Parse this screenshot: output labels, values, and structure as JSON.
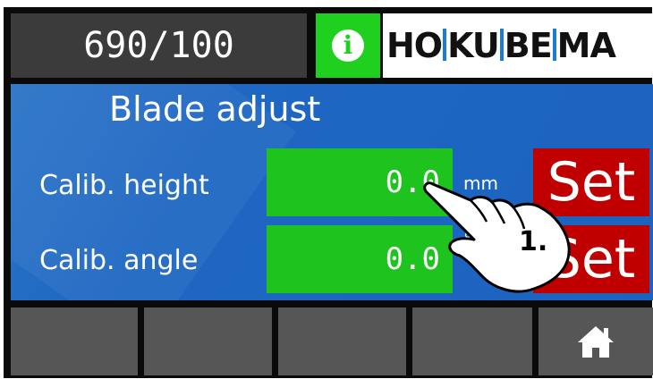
{
  "header": {
    "counter": "690/100",
    "info_icon": "info-icon",
    "logo_parts": [
      "HO",
      "KU",
      "BE",
      "MA"
    ]
  },
  "panel": {
    "title": "Blade adjust",
    "rows": [
      {
        "label": "Calib. height",
        "value": "0.0",
        "unit": "mm",
        "button": "Set"
      },
      {
        "label": "Calib. angle",
        "value": "0.0",
        "unit": "°",
        "button": "Set"
      }
    ]
  },
  "annotation": {
    "step": "1."
  },
  "bottom_bar": {
    "home_icon": "home-icon"
  },
  "colors": {
    "field_green": "#1ec31e",
    "info_green": "#1fd01f",
    "set_red": "#c00000",
    "panel_blue": "#1e67c2",
    "bottom_gray": "#565656",
    "logo_blue": "#1c7bd6"
  }
}
